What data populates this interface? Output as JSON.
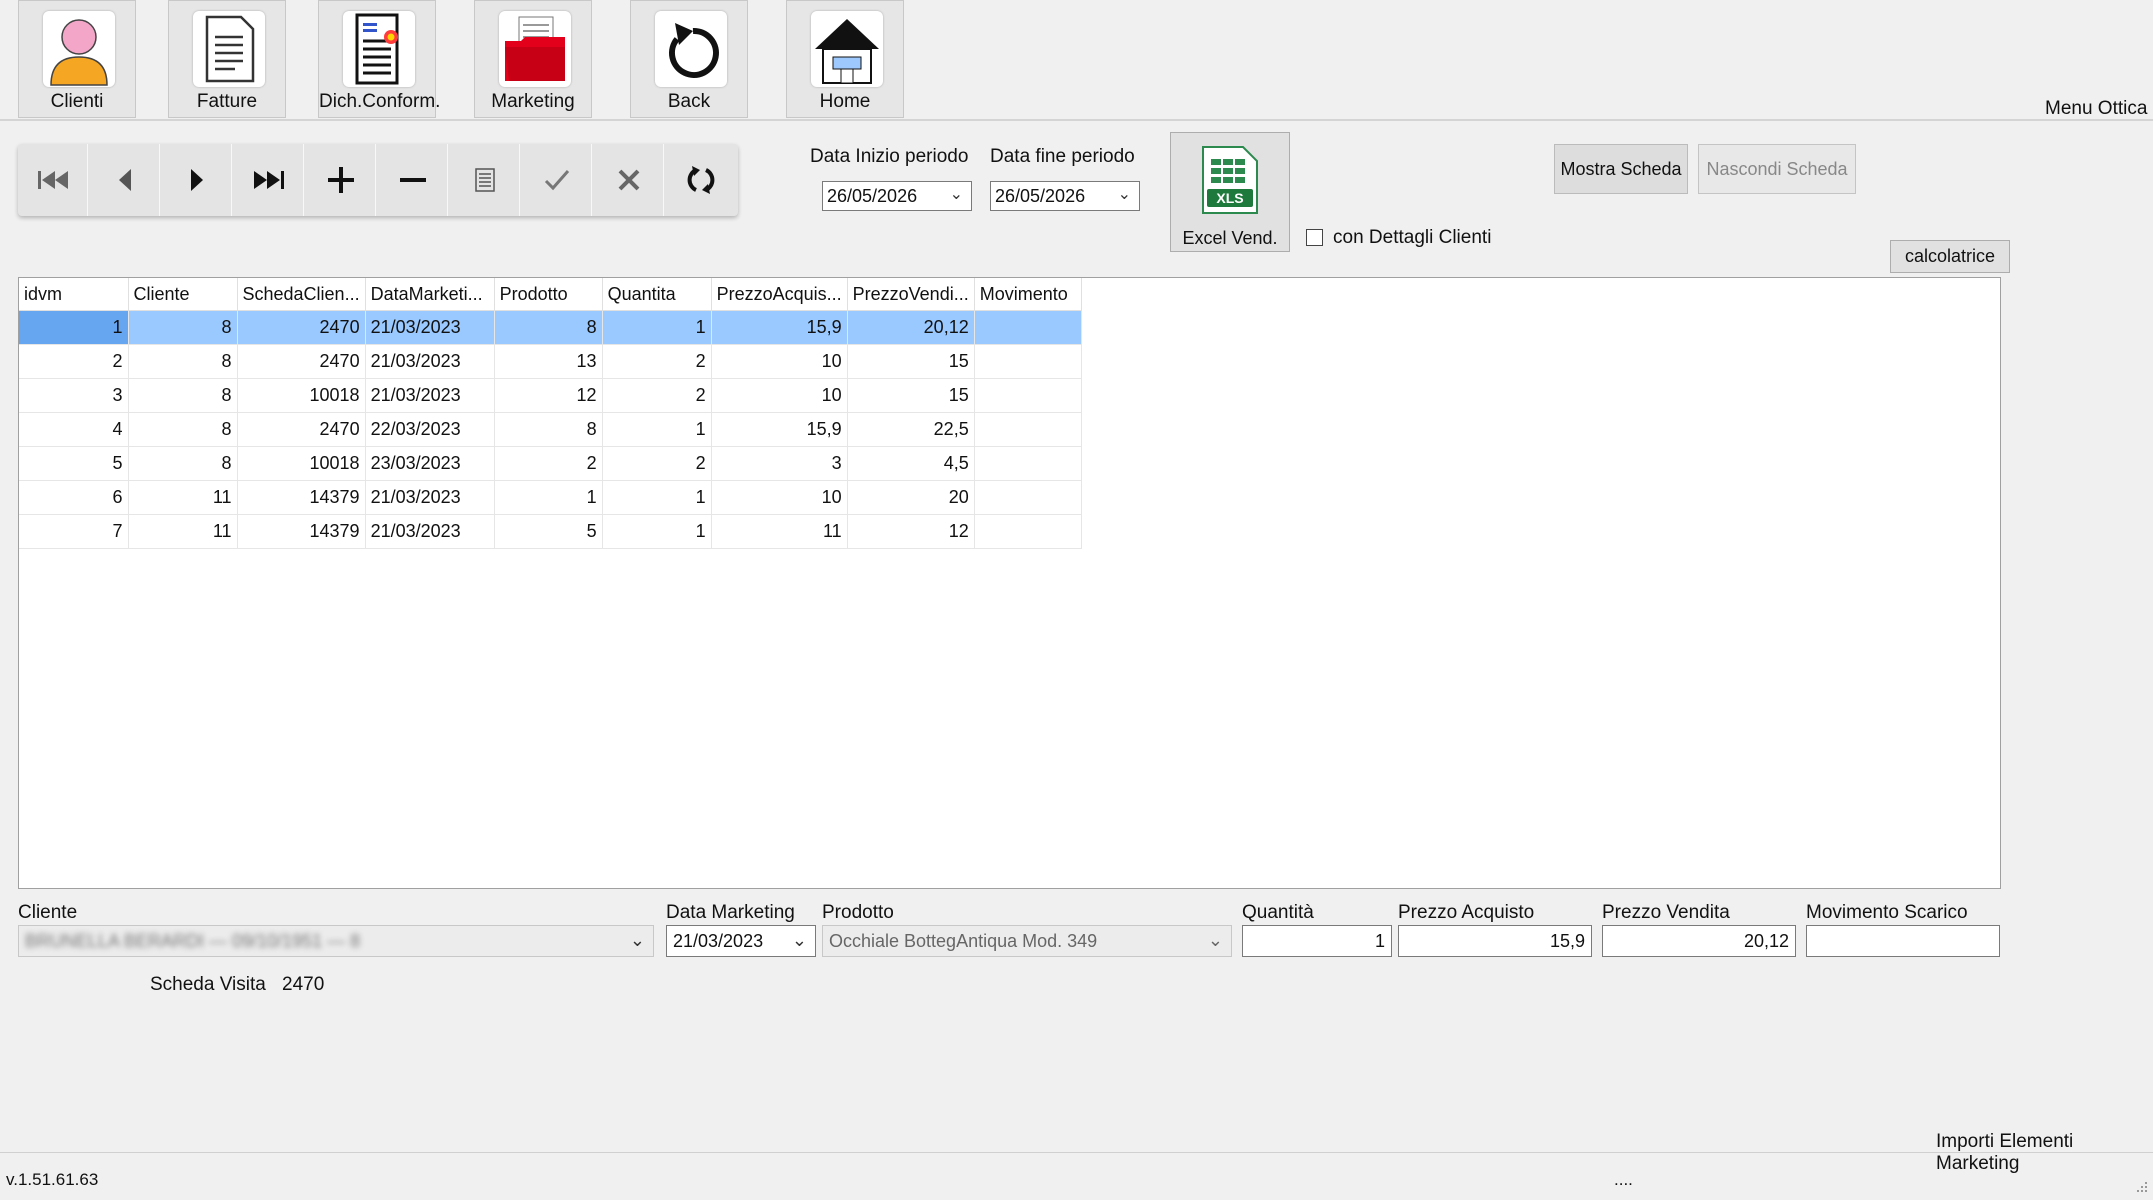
{
  "nav": [
    {
      "label": "Clienti",
      "icon": "person-icon"
    },
    {
      "label": "Fatture",
      "icon": "document-icon"
    },
    {
      "label": "Dich.Conform.",
      "icon": "certificate-icon"
    },
    {
      "label": "Marketing",
      "icon": "folder-icon"
    },
    {
      "label": "Back",
      "icon": "back-arrow-icon"
    },
    {
      "label": "Home",
      "icon": "home-icon"
    }
  ],
  "menu_title": "Menu Ottica",
  "toolbar": [
    "first-record-icon",
    "prev-record-icon",
    "next-record-icon",
    "last-record-icon",
    "add-icon",
    "remove-icon",
    "edit-icon",
    "confirm-icon",
    "cancel-icon",
    "refresh-icon"
  ],
  "period": {
    "start_label": "Data Inizio periodo",
    "start_value": "26/05/2026",
    "end_label": "Data fine periodo",
    "end_value": "26/05/2026"
  },
  "excel": {
    "label": "Excel Vend.",
    "icon_text": "XLS"
  },
  "details_checkbox": "con Dettagli Clienti",
  "buttons": {
    "show": "Mostra Scheda",
    "hide": "Nascondi Scheda",
    "calc": "calcolatrice"
  },
  "grid": {
    "columns": [
      "idvm",
      "Cliente",
      "SchedaClien...",
      "DataMarketi...",
      "Prodotto",
      "Quantita",
      "PrezzoAcquis...",
      "PrezzoVendi...",
      "Movimento"
    ],
    "rows": [
      [
        "1",
        "8",
        "2470",
        "21/03/2023",
        "8",
        "1",
        "15,9",
        "20,12",
        ""
      ],
      [
        "2",
        "8",
        "2470",
        "21/03/2023",
        "13",
        "2",
        "10",
        "15",
        ""
      ],
      [
        "3",
        "8",
        "10018",
        "21/03/2023",
        "12",
        "2",
        "10",
        "15",
        ""
      ],
      [
        "4",
        "8",
        "2470",
        "22/03/2023",
        "8",
        "1",
        "15,9",
        "22,5",
        ""
      ],
      [
        "5",
        "8",
        "10018",
        "23/03/2023",
        "2",
        "2",
        "3",
        "4,5",
        ""
      ],
      [
        "6",
        "11",
        "14379",
        "21/03/2023",
        "1",
        "1",
        "10",
        "20",
        ""
      ],
      [
        "7",
        "11",
        "14379",
        "21/03/2023",
        "5",
        "1",
        "11",
        "12",
        ""
      ]
    ]
  },
  "form": {
    "cliente_label": "Cliente",
    "cliente_value": "BRUNELLA BERARDI — 09/10/1951 — 8",
    "data_label": "Data Marketing",
    "data_value": "21/03/2023",
    "prodotto_label": "Prodotto",
    "prodotto_value": "Occhiale BottegAntiqua Mod. 349",
    "quantita_label": "Quantità",
    "quantita_value": "1",
    "acquisto_label": "Prezzo Acquisto",
    "acquisto_value": "15,9",
    "vendita_label": "Prezzo Vendita",
    "vendita_value": "20,12",
    "movimento_label": "Movimento Scarico",
    "movimento_value": "",
    "scheda_label": "Scheda Visita",
    "scheda_value": "2470"
  },
  "footer": {
    "section": "Importi Elementi Marketing",
    "version": "v.1.51.61.63",
    "status": "...."
  }
}
